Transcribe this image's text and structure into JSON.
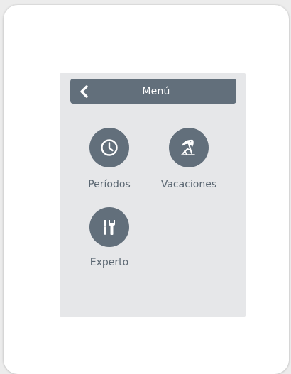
{
  "header": {
    "title": "Menú",
    "back_icon": "chevron-left-icon"
  },
  "menu": {
    "items": [
      {
        "label": "Períodos",
        "icon": "clock-icon"
      },
      {
        "label": "Vacaciones",
        "icon": "beach-umbrella-icon"
      },
      {
        "label": "Experto",
        "icon": "tools-icon"
      }
    ]
  },
  "colors": {
    "accent": "#626f7b",
    "screen_background": "#e6e7e9",
    "label_text": "#5b6772"
  }
}
